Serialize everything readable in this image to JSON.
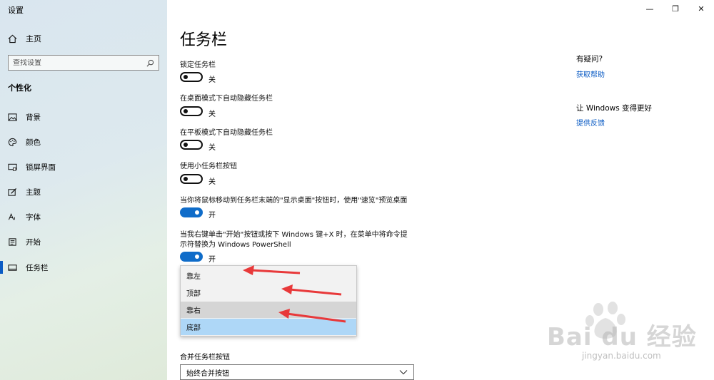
{
  "app": {
    "title": "设置"
  },
  "window": {
    "minimize": "—",
    "maximize": "❐",
    "close": "✕"
  },
  "sidebar": {
    "home": "主页",
    "search_placeholder": "查找设置",
    "section": "个性化",
    "items": [
      {
        "label": "背景",
        "icon": "image-icon"
      },
      {
        "label": "颜色",
        "icon": "palette-icon"
      },
      {
        "label": "锁屏界面",
        "icon": "lock-screen-icon"
      },
      {
        "label": "主题",
        "icon": "theme-icon"
      },
      {
        "label": "字体",
        "icon": "font-icon"
      },
      {
        "label": "开始",
        "icon": "start-icon"
      },
      {
        "label": "任务栏",
        "icon": "taskbar-icon",
        "active": true
      }
    ]
  },
  "main": {
    "title": "任务栏",
    "settings": [
      {
        "label": "锁定任务栏",
        "state": "关",
        "on": false
      },
      {
        "label": "在桌面模式下自动隐藏任务栏",
        "state": "关",
        "on": false
      },
      {
        "label": "在平板模式下自动隐藏任务栏",
        "state": "关",
        "on": false
      },
      {
        "label": "使用小任务栏按钮",
        "state": "关",
        "on": false
      },
      {
        "label": "当你将鼠标移动到任务栏末端的\"显示桌面\"按钮时，使用\"速览\"预览桌面",
        "state": "开",
        "on": true
      },
      {
        "label_line1": "当我右键单击\"开始\"按钮或按下 Windows 键+X 时，在菜单中将命令提",
        "label_line2": "示符替换为 Windows PowerShell",
        "state": "开",
        "on": true
      }
    ],
    "position_options": [
      "靠左",
      "顶部",
      "靠右",
      "底部"
    ],
    "combine_label": "合并任务栏按钮",
    "combine_value": "始终合并按钮"
  },
  "help": {
    "question": "有疑问?",
    "get_help": "获取帮助",
    "improve": "让 Windows 变得更好",
    "feedback": "提供反馈"
  },
  "watermark": {
    "brand": "Bai du 经验",
    "url": "jingyan.baidu.com"
  },
  "colors": {
    "accent": "#0f6cc9",
    "link": "#0a5bc4",
    "arrow": "#e8393a",
    "selected": "#aed7f7"
  }
}
